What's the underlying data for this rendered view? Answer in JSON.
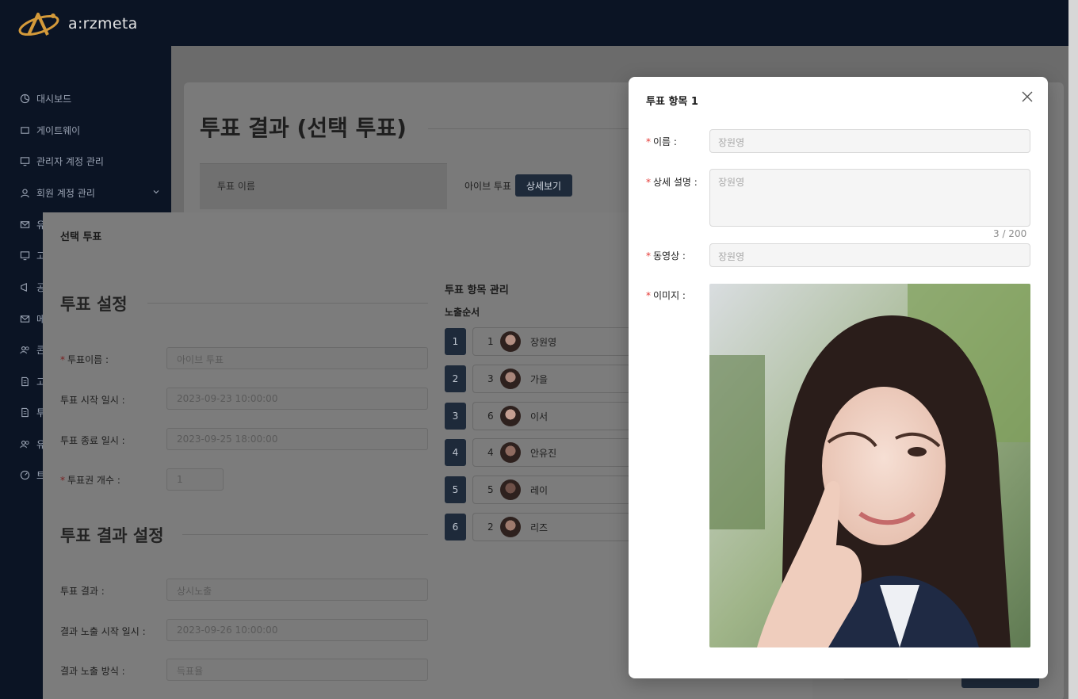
{
  "app": {
    "logo_text": "a:rzmeta"
  },
  "sidebar": {
    "items": [
      {
        "label": "대시보드",
        "icon": "chart-pie-icon"
      },
      {
        "label": "게이트웨이",
        "icon": "gateway-icon"
      },
      {
        "label": "관리자 계정 관리",
        "icon": "monitor-icon"
      },
      {
        "label": "회원 계정 관리",
        "icon": "user-icon",
        "expandable": true
      },
      {
        "label": "유",
        "icon": "mail-icon"
      },
      {
        "label": "고",
        "icon": "monitor-icon"
      },
      {
        "label": "공",
        "icon": "megaphone-icon"
      },
      {
        "label": "메",
        "icon": "mail-icon"
      },
      {
        "label": "콘",
        "icon": "user-group-icon"
      },
      {
        "label": "고",
        "icon": "document-icon"
      },
      {
        "label": "투",
        "icon": "document-icon"
      },
      {
        "label": "유",
        "icon": "user-group-icon"
      },
      {
        "label": "트",
        "icon": "dashboard-icon"
      }
    ]
  },
  "background_page": {
    "title": "투표 결과 (선택 투표)",
    "table": {
      "header": "투표 이름",
      "value": "아이브 투표",
      "detail_button": "상세보기"
    }
  },
  "vote_modal": {
    "title": "선택 투표",
    "settings_section": "투표 설정",
    "fields": [
      {
        "label": "투표이름 :",
        "required": true,
        "value": "아이브 투표"
      },
      {
        "label": "투표 시작 일시 :",
        "required": false,
        "value": "2023-09-23 10:00:00"
      },
      {
        "label": "투표 종료 일시 :",
        "required": false,
        "value": "2023-09-25 18:00:00"
      },
      {
        "label": "투표권 개수 :",
        "required": true,
        "value": "1"
      }
    ],
    "result_section": "투표 결과 설정",
    "result_fields": [
      {
        "label": "투표 결과 :",
        "value": "상시노출"
      },
      {
        "label": "결과 노출 시작 일시 :",
        "value": "2023-09-26 10:00:00"
      },
      {
        "label": "결과 노출 방식 :",
        "value": "득표율"
      }
    ],
    "management_title": "투표 항목 관리",
    "order_title": "노출순서",
    "order_items": [
      {
        "order": "1",
        "index": "1",
        "name": "장원영"
      },
      {
        "order": "2",
        "index": "3",
        "name": "가을"
      },
      {
        "order": "3",
        "index": "6",
        "name": "이서"
      },
      {
        "order": "4",
        "index": "4",
        "name": "안유진"
      },
      {
        "order": "5",
        "index": "5",
        "name": "레이"
      },
      {
        "order": "6",
        "index": "2",
        "name": "리즈"
      }
    ]
  },
  "item_modal": {
    "title": "투표 항목 1",
    "name_label": "이름 :",
    "name_value": "장원영",
    "desc_label": "상세 설명 :",
    "desc_value": "장원영",
    "desc_counter": "3 / 200",
    "video_label": "동영상 :",
    "video_value": "장원영",
    "image_label": "이미지 :"
  },
  "colors": {
    "navy": "#0b1424",
    "button": "#1e2a3a",
    "required": "#e53935"
  }
}
